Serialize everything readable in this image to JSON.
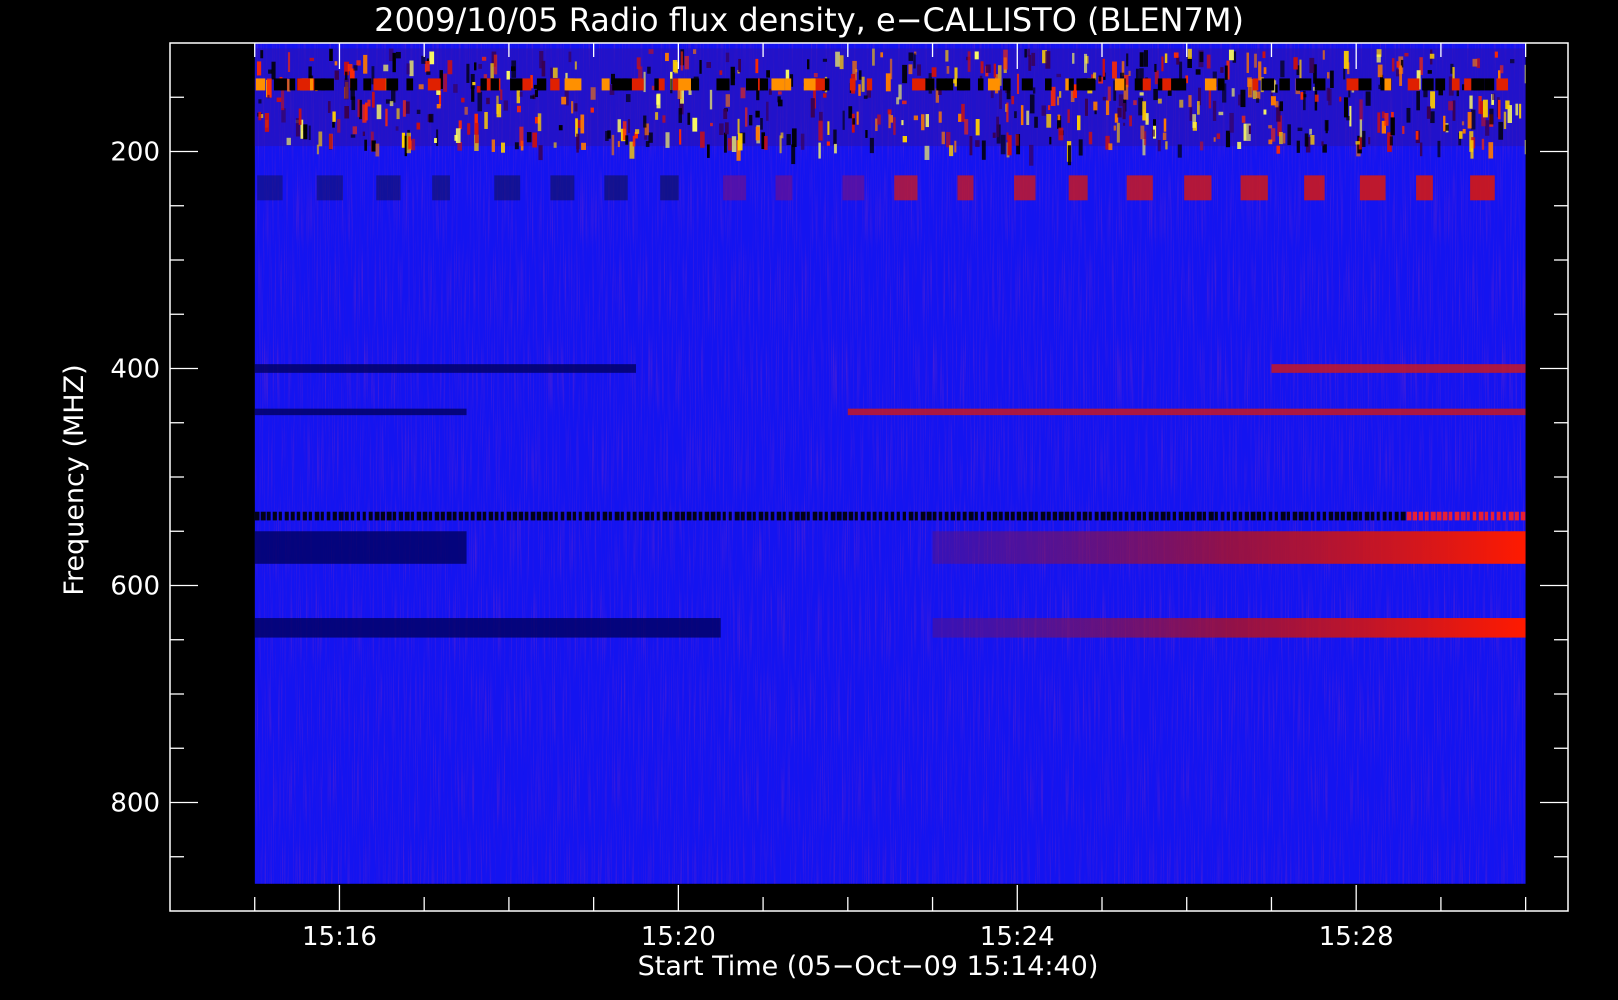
{
  "chart_data": {
    "type": "heatmap",
    "title": "2009/10/05  Radio flux density, e−CALLISTO (BLEN7M)",
    "xlabel": "Start Time (05−Oct−09 15:14:40)",
    "ylabel": "Frequency (MHZ)",
    "x_range": [
      "15:14:00",
      "15:30:30"
    ],
    "data_x_range": [
      "15:15:00",
      "15:30:00"
    ],
    "ylim": [
      900,
      100
    ],
    "data_y_range": [
      100,
      875
    ],
    "x_ticks": [
      "15:16",
      "15:20",
      "15:24",
      "15:28"
    ],
    "y_ticks": [
      200,
      400,
      600,
      800
    ],
    "colormap": [
      "#000000",
      "#0000ff",
      "#ff0000",
      "#ffff00"
    ],
    "background_color": "#1414f0",
    "features": [
      {
        "kind": "rfi-band",
        "freq": [
          105,
          195
        ],
        "time": [
          "15:15:00",
          "15:30:00"
        ],
        "level": "speckled-red-yellow"
      },
      {
        "kind": "periodic-band",
        "freq": [
          222,
          245
        ],
        "time": [
          "15:15:00",
          "15:30:00"
        ],
        "level": "red-bursts"
      },
      {
        "kind": "band",
        "freq": [
          396,
          404
        ],
        "time": [
          "15:15:00",
          "15:19:30"
        ],
        "level": "dark"
      },
      {
        "kind": "band",
        "freq": [
          396,
          404
        ],
        "time": [
          "15:27:00",
          "15:30:00"
        ],
        "level": "red"
      },
      {
        "kind": "band",
        "freq": [
          437,
          443
        ],
        "time": [
          "15:15:00",
          "15:17:30"
        ],
        "level": "dark"
      },
      {
        "kind": "band",
        "freq": [
          437,
          443
        ],
        "time": [
          "15:22:00",
          "15:30:00"
        ],
        "level": "red"
      },
      {
        "kind": "band",
        "freq": [
          532,
          540
        ],
        "time": [
          "15:15:00",
          "15:30:00"
        ],
        "level": "dark-dashed"
      },
      {
        "kind": "band",
        "freq": [
          550,
          580
        ],
        "time": [
          "15:15:00",
          "15:17:30"
        ],
        "level": "dark"
      },
      {
        "kind": "band",
        "freq": [
          550,
          580
        ],
        "time": [
          "15:23:00",
          "15:30:00"
        ],
        "level": "red-intensifying"
      },
      {
        "kind": "band",
        "freq": [
          630,
          648
        ],
        "time": [
          "15:15:00",
          "15:20:30"
        ],
        "level": "dark"
      },
      {
        "kind": "band",
        "freq": [
          630,
          648
        ],
        "time": [
          "15:23:00",
          "15:30:00"
        ],
        "level": "red-intensifying"
      }
    ]
  }
}
